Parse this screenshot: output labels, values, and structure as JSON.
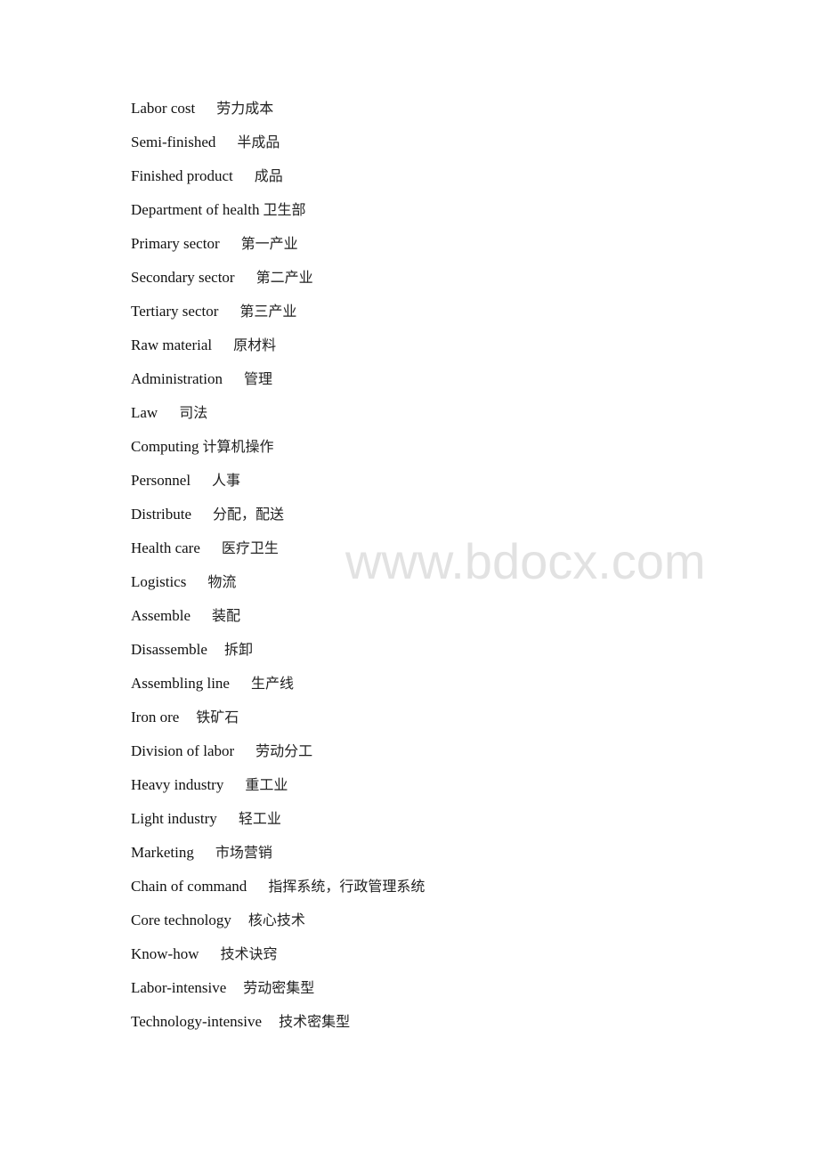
{
  "document": {
    "entries": [
      {
        "term": "Labor cost",
        "translation": "劳力成本",
        "gap": 24
      },
      {
        "term": "Semi-finished",
        "translation": "半成品",
        "gap": 24
      },
      {
        "term": "Finished product",
        "translation": "成品",
        "gap": 24
      },
      {
        "term": "Department of health",
        "translation": "卫生部",
        "gap": 4
      },
      {
        "term": "Primary sector",
        "translation": "第一产业",
        "gap": 24
      },
      {
        "term": "Secondary sector",
        "translation": "第二产业",
        "gap": 24
      },
      {
        "term": "Tertiary sector",
        "translation": "第三产业",
        "gap": 24
      },
      {
        "term": "Raw material",
        "translation": "原材料",
        "gap": 24
      },
      {
        "term": "Administration",
        "translation": "管理",
        "gap": 24
      },
      {
        "term": "Law",
        "translation": "司法",
        "gap": 24
      },
      {
        "term": "Computing",
        "translation": "计算机操作",
        "gap": 4
      },
      {
        "term": "Personnel",
        "translation": "人事",
        "gap": 24
      },
      {
        "term": "Distribute",
        "translation": "分配，配送",
        "gap": 24
      },
      {
        "term": "Health care",
        "translation": "医疗卫生",
        "gap": 24
      },
      {
        "term": "Logistics",
        "translation": "物流",
        "gap": 24
      },
      {
        "term": "Assemble",
        "translation": "装配",
        "gap": 24
      },
      {
        "term": "Disassemble",
        "translation": "拆卸",
        "gap": 19
      },
      {
        "term": "Assembling line",
        "translation": "生产线",
        "gap": 24
      },
      {
        "term": "Iron ore",
        "translation": "铁矿石",
        "gap": 19
      },
      {
        "term": "Division of labor",
        "translation": "劳动分工",
        "gap": 24
      },
      {
        "term": "Heavy industry",
        "translation": "重工业",
        "gap": 24
      },
      {
        "term": "Light industry",
        "translation": "轻工业",
        "gap": 24
      },
      {
        "term": "Marketing",
        "translation": "市场营销",
        "gap": 24
      },
      {
        "term": "Chain of command",
        "translation": "指挥系统，行政管理系统",
        "gap": 24
      },
      {
        "term": "Core technology",
        "translation": "核心技术",
        "gap": 19
      },
      {
        "term": "Know-how",
        "translation": "技术诀窍",
        "gap": 24
      },
      {
        "term": "Labor-intensive",
        "translation": "劳动密集型",
        "gap": 19
      },
      {
        "term": "Technology-intensive",
        "translation": "技术密集型",
        "gap": 19
      }
    ]
  },
  "watermark": {
    "text": "www.bdocx.com",
    "color": "#e2e2e2"
  }
}
